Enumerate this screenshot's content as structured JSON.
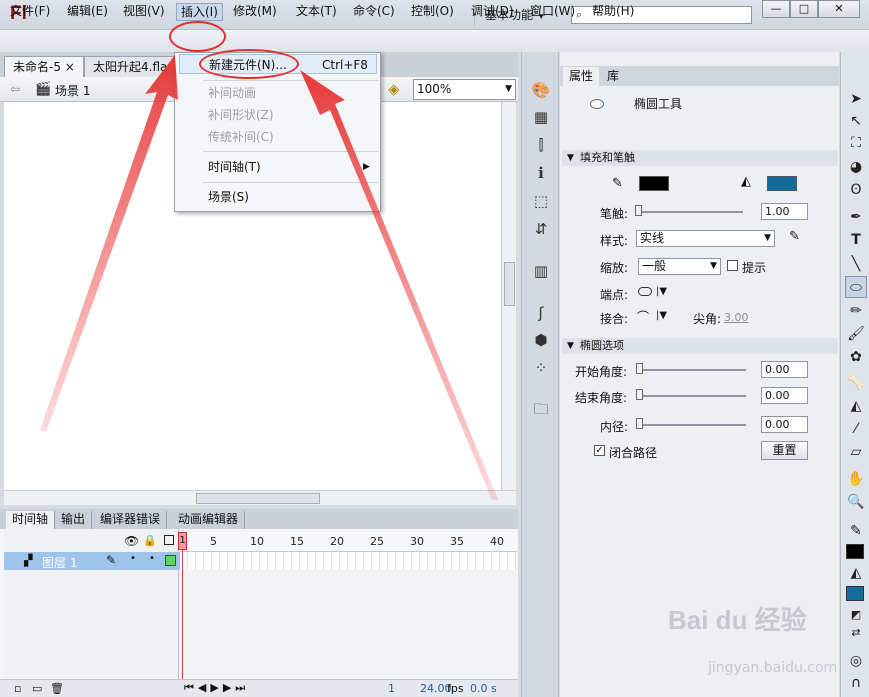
{
  "app": {
    "logo": "Fl",
    "workspace": "基本功能",
    "search_placeholder": ""
  },
  "window_buttons": {
    "minimize": "—",
    "maximize": "□",
    "close": "✕"
  },
  "menu": [
    "文件(F)",
    "编辑(E)",
    "视图(V)",
    "插入(I)",
    "修改(M)",
    "文本(T)",
    "命令(C)",
    "控制(O)",
    "调试(D)",
    "窗口(W)",
    "帮助(H)"
  ],
  "doc_tabs": [
    {
      "label": "未命名-5",
      "close": "×"
    },
    {
      "label": "太阳升起4.fla",
      "close": ""
    }
  ],
  "scene": {
    "name": "场景 1",
    "zoom": "100%"
  },
  "insert_menu": {
    "new_symbol": "新建元件(N)...",
    "new_symbol_shortcut": "Ctrl+F8",
    "motion_tween": "补间动画",
    "shape_tween": "补间形状(Z)",
    "classic_tween": "传统补间(C)",
    "timeline": "时间轴(T)",
    "scene": "场景(S)"
  },
  "timeline": {
    "tabs": [
      "时间轴",
      "输出",
      "编译器错误",
      "动画编辑器"
    ],
    "layer_name": "图层 1",
    "ruler": [
      "1",
      "5",
      "10",
      "15",
      "20",
      "25",
      "30",
      "35",
      "40"
    ],
    "frame": "1",
    "fps": "24.00",
    "fps_unit": "fps",
    "time": "0.0 s"
  },
  "properties": {
    "tabs": [
      "属性",
      "库"
    ],
    "tool_name": "椭圆工具",
    "section_fill_stroke": "填充和笔触",
    "stroke_color": "#000000",
    "fill_color": "#156b9b",
    "stroke_label": "笔触:",
    "stroke_value": "1.00",
    "style_label": "样式:",
    "style_value": "实线",
    "scale_label": "缩放:",
    "scale_value": "一般",
    "hint_label": "提示",
    "cap_label": "端点:",
    "join_label": "接合:",
    "miter_label": "尖角:",
    "miter_value": "3.00",
    "section_oval": "椭圆选项",
    "start_angle_label": "开始角度:",
    "start_angle_value": "0.00",
    "end_angle_label": "结束角度:",
    "end_angle_value": "0.00",
    "inner_radius_label": "内径:",
    "inner_radius_value": "0.00",
    "close_path_label": "闭合路径",
    "reset_label": "重置"
  },
  "watermark": {
    "logo": "Bai du 经验",
    "url": "jingyan.baidu.com"
  }
}
